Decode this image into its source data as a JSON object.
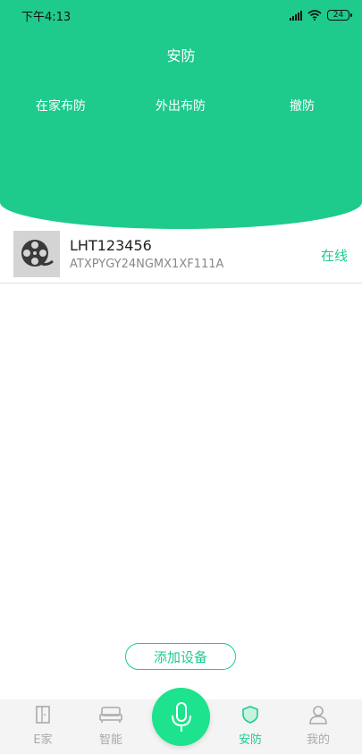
{
  "status_bar": {
    "time": "下午4:13",
    "battery": "24"
  },
  "header": {
    "title": "安防",
    "arm_home_label": "在家布防",
    "arm_away_label": "外出布防",
    "disarm_label": "撤防"
  },
  "device": {
    "name": "LHT123456",
    "serial": "ATXPYGY24NGMX1XF111A",
    "status": "在线",
    "icon": "film-reel-icon"
  },
  "add_device_label": "添加设备",
  "tabbar": {
    "home_label": "E家",
    "smart_label": "智能",
    "security_label": "安防",
    "profile_label": "我的"
  },
  "colors": {
    "accent": "#1ecb8c",
    "mic": "#1de28e",
    "inactive": "#aaaaaa"
  }
}
